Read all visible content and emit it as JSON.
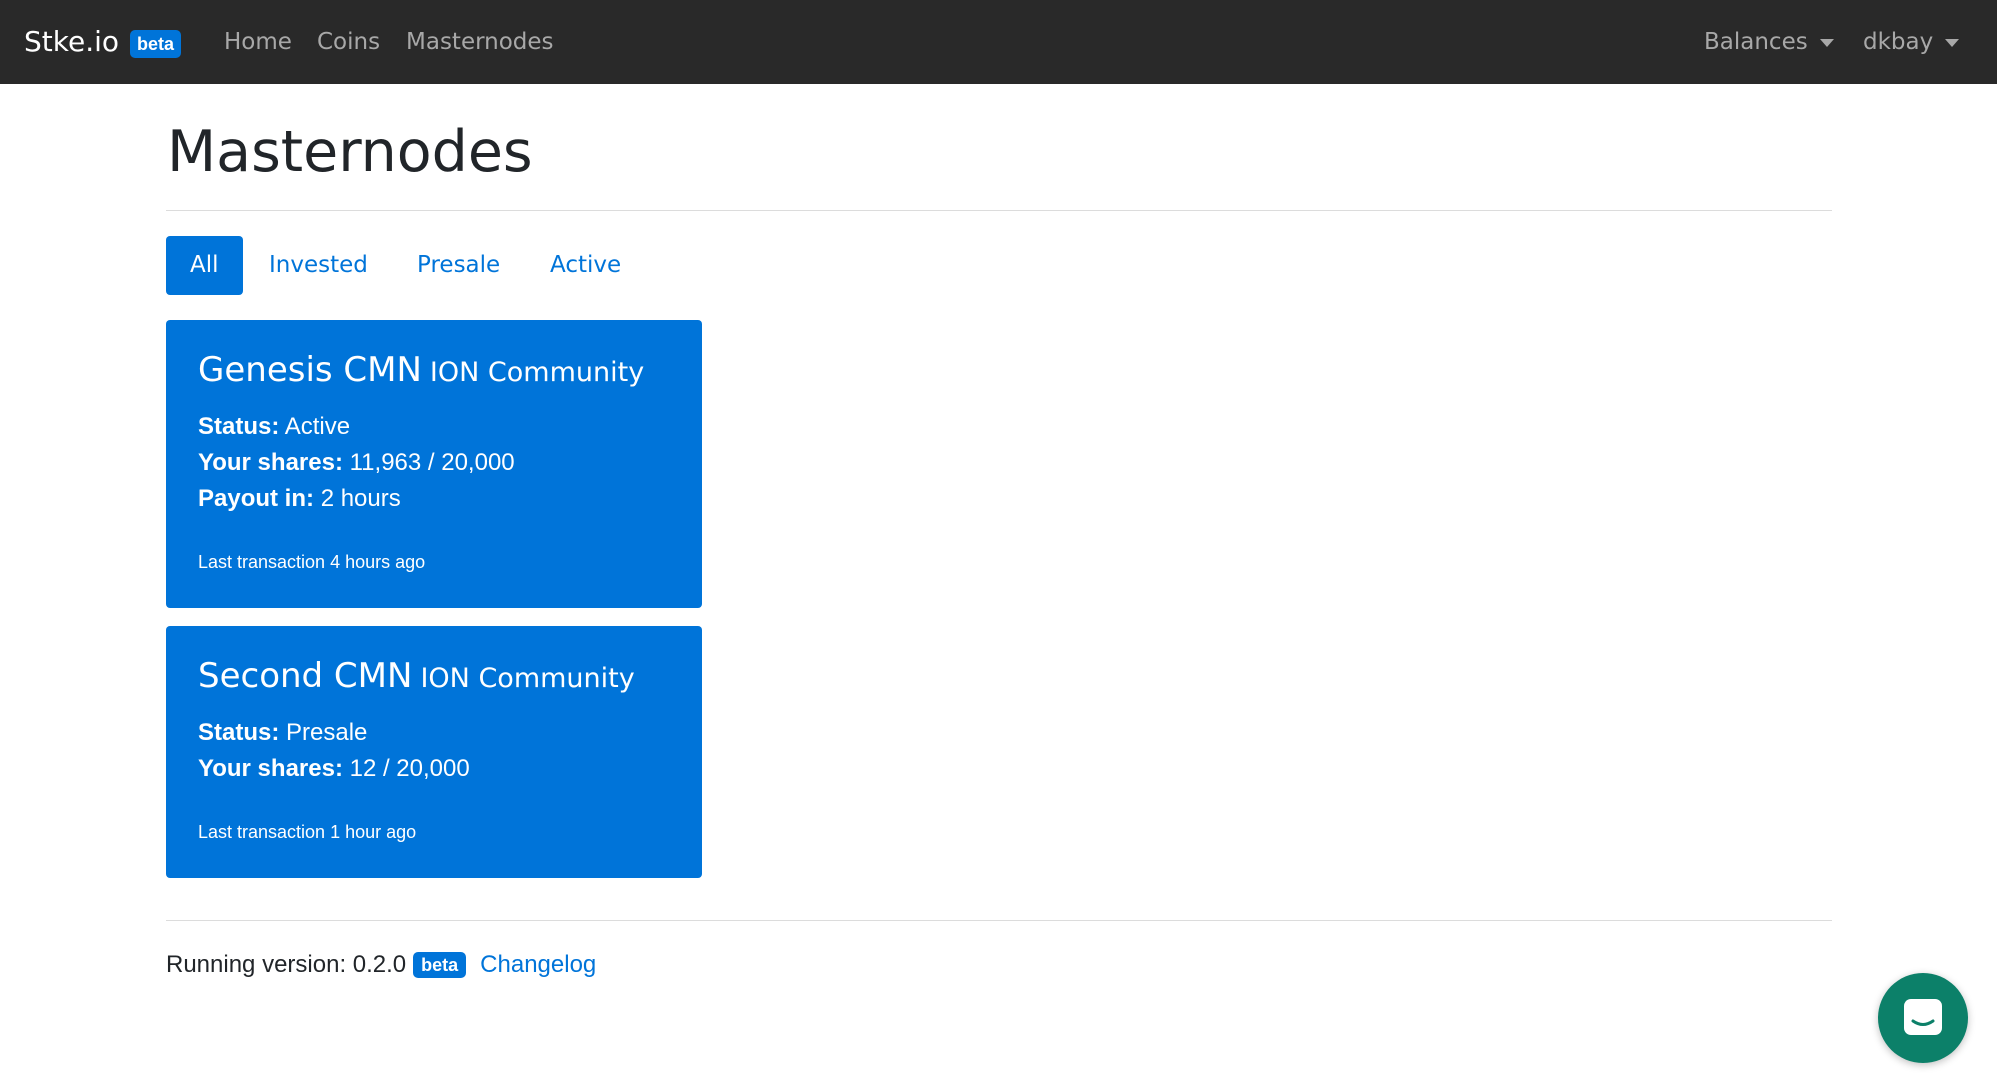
{
  "navbar": {
    "brand": "Stke.io",
    "brand_badge": "beta",
    "links": [
      "Home",
      "Coins",
      "Masternodes"
    ],
    "right_menus": [
      "Balances",
      "dkbay"
    ]
  },
  "page": {
    "title": "Masternodes"
  },
  "tabs": {
    "items": [
      "All",
      "Invested",
      "Presale",
      "Active"
    ],
    "active": "All"
  },
  "cards": [
    {
      "name": "Genesis CMN",
      "community": "ION Community",
      "status_label": "Status:",
      "status": "Active",
      "shares_label": "Your shares:",
      "shares": "11,963 / 20,000",
      "payout_label": "Payout in:",
      "payout": "2 hours",
      "last_transaction": "Last transaction 4 hours ago"
    },
    {
      "name": "Second CMN",
      "community": "ION Community",
      "status_label": "Status:",
      "status": "Presale",
      "shares_label": "Your shares:",
      "shares": "12 / 20,000",
      "last_transaction": "Last transaction 1 hour ago"
    }
  ],
  "footer": {
    "version_text": "Running version: 0.2.0",
    "badge": "beta",
    "changelog_link": "Changelog"
  },
  "colors": {
    "navbar_bg": "#292929",
    "accent": "#0074d9",
    "chat_button": "#0c8069"
  },
  "icons": {
    "chat": "chat-bubble-icon",
    "dropdown": "caret-down-icon"
  }
}
